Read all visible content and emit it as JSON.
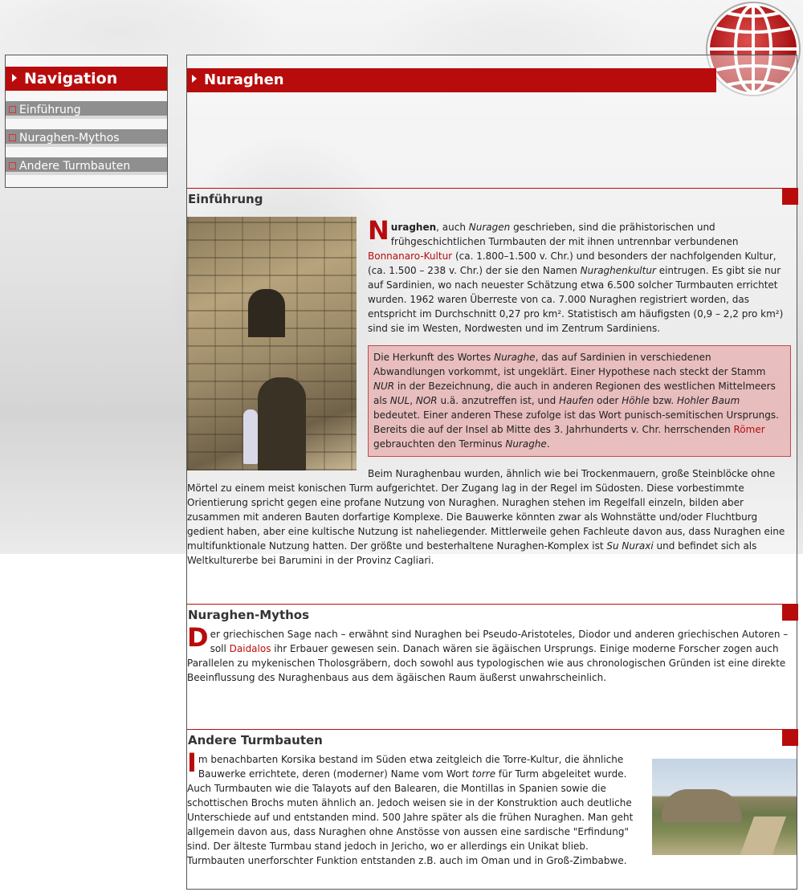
{
  "sidebar": {
    "title": "Navigation",
    "items": [
      {
        "label": "Einführung"
      },
      {
        "label": "Nuraghen-Mythos"
      },
      {
        "label": "Andere Turmbauten"
      }
    ]
  },
  "main": {
    "title": "Nuraghen"
  },
  "sections": {
    "intro": {
      "heading": "Einführung",
      "p1_cap": "N",
      "p1_a": "uraghen",
      "p1_b": ", auch ",
      "p1_c": "Nuragen",
      "p1_d": " geschrieben, sind die prähistorischen und frühgeschichtlichen Turmbauten der mit ihnen untrennbar verbundenen ",
      "p1_link": "Bonnanaro-Kultur",
      "p1_e": " (ca. 1.800–1.500 v. Chr.) und besonders der nachfolgenden Kultur, (ca. 1.500 – 238 v. Chr.) der sie den Namen ",
      "p1_f": "Nuraghenkultur",
      "p1_g": " eintrugen. Es gibt sie nur auf Sardinien, wo nach neuester Schätzung etwa 6.500 solcher Turmbauten errichtet wurden. 1962 waren Überreste von ca. 7.000 Nuraghen registriert worden, das entspricht im Durchschnitt 0,27 pro km². Statistisch am häufigsten (0,9 – 2,2 pro km²) sind sie im Westen, Nordwesten und im Zentrum Sardiniens.",
      "box_a": "Die Herkunft des Wortes ",
      "box_b": "Nuraghe",
      "box_c": ", das auf Sardinien in verschiedenen Abwandlungen vorkommt, ist ungeklärt. Einer Hypothese nach steckt der Stamm ",
      "box_d": "NUR",
      "box_e": " in der Bezeichnung, die auch in anderen Regionen des westlichen Mittelmeers als ",
      "box_f": "NUL",
      "box_g": ", ",
      "box_h": "NOR",
      "box_i": " u.ä. anzutreffen ist, und ",
      "box_j": "Haufen",
      "box_k": " oder ",
      "box_l": "Höhle",
      "box_m": " bzw. ",
      "box_n": "Hohler Baum",
      "box_o": " bedeutet. Einer anderen These zufolge ist das Wort punisch-semitischen Ursprungs. Bereits die auf der Insel ab Mitte des 3. Jahrhunderts v. Chr. herrschenden ",
      "box_link": "Römer",
      "box_p": " gebrauchten den Terminus ",
      "box_q": "Nuraghe",
      "box_r": ".",
      "p2_a": "Beim Nuraghenbau wurden, ähnlich wie bei Trockenmauern, große Steinblöcke ohne Mörtel zu einem meist konischen Turm aufgerichtet. Der Zugang lag in der Regel im Südosten. Diese vorbestimmte Orientierung spricht gegen eine profane Nutzung von Nuraghen. Nuraghen stehen im Regelfall einzeln, bilden aber zusammen mit anderen Bauten dorfartige Komplexe. Die Bauwerke könnten zwar als Wohnstätte und/oder Fluchtburg gedient haben, aber eine kultische Nutzung ist naheliegender. Mittlerweile gehen Fachleute davon aus, dass Nuraghen eine multifunktionale Nutzung hatten. Der größte und besterhaltene Nuraghen-Komplex ist ",
      "p2_b": "Su Nuraxi",
      "p2_c": " und befindet sich als Weltkulturerbe bei Barumini in der Provinz Cagliari."
    },
    "mythos": {
      "heading": "Nuraghen-Mythos",
      "cap": "D",
      "a": "er griechischen Sage nach – erwähnt sind Nuraghen bei Pseudo-Aristoteles, Diodor und anderen griechischen Autoren – soll ",
      "link": "Daidalos",
      "b": " ihr Erbauer gewesen sein. Danach wären sie ägäischen Ursprungs. Einige moderne Forscher zogen auch Parallelen zu mykenischen Tholosgräbern, doch sowohl aus typologischen wie aus chronologischen Gründen ist eine direkte Beeinflussung des Nuraghenbaus aus dem ägäischen Raum äußerst unwahrscheinlich."
    },
    "andere": {
      "heading": "Andere Turmbauten",
      "cap": "I",
      "a": "m benachbarten Korsika bestand im Süden etwa zeitgleich die Torre-Kultur, die ähnliche Bauwerke errichtete, deren (moderner) Name vom Wort ",
      "b": "torre",
      "c": " für Turm abgeleitet wurde. Auch Turmbauten wie die Talayots auf den Balearen, die Montillas in Spanien sowie die schottischen Brochs muten ähnlich an. Jedoch weisen sie in der Konstruktion auch deutliche Unterschiede auf und entstanden mind. 500 Jahre später als die frühen Nuraghen. Man geht allgemein davon aus, dass Nuraghen ohne Anstösse von aussen eine sardische \"Erfindung\" sind. Der älteste Turmbau stand jedoch in Jericho, wo er allerdings ein Unikat blieb. Turmbauten unerforschter Funktion entstanden z.B. auch im Oman und in Groß-Zimbabwe."
    }
  },
  "colors": {
    "accent": "#b80c0c",
    "nav_item": "#8f8f8f",
    "infobox": "#e6a0a0"
  },
  "icons": {
    "logo": "globe-logo-icon",
    "bullet": "triangle-bullet-icon",
    "nav_bullet": "square-bullet-icon"
  }
}
